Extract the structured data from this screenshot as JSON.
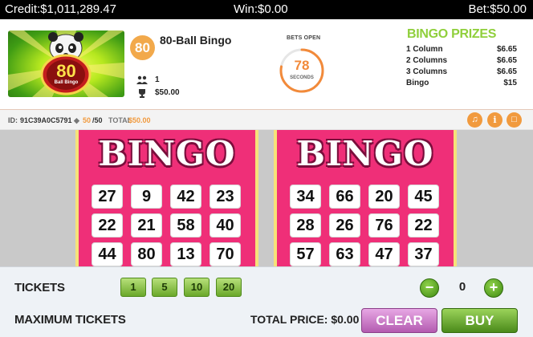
{
  "topbar": {
    "credit": "Credit:$1,011,289.47",
    "win": "Win:$0.00",
    "bet": "Bet:$50.00"
  },
  "room": {
    "badge": "80",
    "name": "80-Ball Bingo",
    "logo_number": "80",
    "logo_caption": "Ball Bingo",
    "players": "1",
    "jackpot": "$50.00"
  },
  "countdown": {
    "status": "BETS OPEN",
    "seconds": "78",
    "unit": "SECONDS",
    "fraction_remaining": 0.78
  },
  "prizes": {
    "title": "BINGO PRIZES",
    "rows": [
      {
        "label": "1 Column",
        "value": "$6.65"
      },
      {
        "label": "2 Columns",
        "value": "$6.65"
      },
      {
        "label": "3 Columns",
        "value": "$6.65"
      },
      {
        "label": "Bingo",
        "value": "$15"
      }
    ]
  },
  "info": {
    "id_label": "ID:",
    "id_value": "91C39A0C5791",
    "tickets_bought": "50",
    "tickets_max": "/50",
    "total_label": "TOTAL",
    "total_value": "$50.00"
  },
  "cards": [
    {
      "title": "BINGO",
      "rows": [
        [
          "27",
          "9",
          "42",
          "23"
        ],
        [
          "22",
          "21",
          "58",
          "40"
        ],
        [
          "44",
          "80",
          "13",
          "70"
        ]
      ]
    },
    {
      "title": "BINGO",
      "rows": [
        [
          "34",
          "66",
          "20",
          "45"
        ],
        [
          "28",
          "26",
          "76",
          "22"
        ],
        [
          "57",
          "63",
          "47",
          "37"
        ]
      ]
    }
  ],
  "controls": {
    "tickets_label": "TICKETS",
    "quick_picks": [
      "1",
      "5",
      "10",
      "20"
    ],
    "count": "0",
    "max_label": "MAXIMUM TICKETS",
    "total_price": "TOTAL PRICE: $0.00",
    "clear_label": "CLEAR",
    "buy_label": "BUY"
  },
  "colors": {
    "accent_orange": "#f19a3e",
    "card_pink": "#ef2f78",
    "prize_green": "#8fcf3b",
    "button_green": "#6aa82a",
    "button_purple": "#b35bb0"
  },
  "icons": [
    "players-icon",
    "trophy-icon",
    "sound-icon",
    "info-icon",
    "chat-icon",
    "ticket-icon",
    "minus-icon",
    "plus-icon",
    "panda-icon"
  ]
}
